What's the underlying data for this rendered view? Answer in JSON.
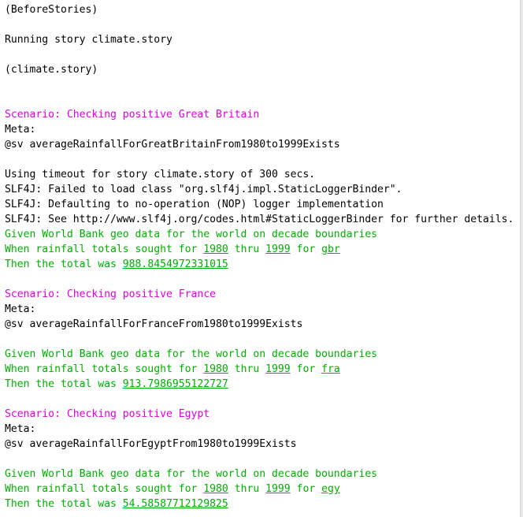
{
  "colors": {
    "scenario": "#e000e0",
    "step": "#00b000",
    "default": "#000000",
    "background": "#ffffff"
  },
  "console": {
    "before_stories": "(BeforeStories)",
    "running_story": "Running story climate.story",
    "story_name": "(climate.story)",
    "scenarios": [
      {
        "title": "Scenario: Checking positive Great Britain",
        "meta_label": "Meta:",
        "meta_value": "@sv averageRainfallForGreatBritainFrom1980to1999Exists",
        "given": "Given World Bank geo data for the world on decade boundaries",
        "when_prefix": "When rainfall totals sought for ",
        "when_from": "1980",
        "when_mid": " thru ",
        "when_to": "1999",
        "when_for": " for ",
        "when_country": "gbr",
        "then_prefix": "Then the total was ",
        "then_value": "988.8454972331015"
      },
      {
        "title": "Scenario: Checking positive France",
        "meta_label": "Meta:",
        "meta_value": "@sv averageRainfallForFranceFrom1980to1999Exists",
        "given": "Given World Bank geo data for the world on decade boundaries",
        "when_prefix": "When rainfall totals sought for ",
        "when_from": "1980",
        "when_mid": " thru ",
        "when_to": "1999",
        "when_for": " for ",
        "when_country": "fra",
        "then_prefix": "Then the total was ",
        "then_value": "913.7986955122727"
      },
      {
        "title": "Scenario: Checking positive Egypt",
        "meta_label": "Meta:",
        "meta_value": "@sv averageRainfallForEgyptFrom1980to1999Exists",
        "given": "Given World Bank geo data for the world on decade boundaries",
        "when_prefix": "When rainfall totals sought for ",
        "when_from": "1980",
        "when_mid": " thru ",
        "when_to": "1999",
        "when_for": " for ",
        "when_country": "egy",
        "then_prefix": "Then the total was ",
        "then_value": "54.58587712129825"
      }
    ],
    "log_lines": [
      "Using timeout for story climate.story of 300 secs.",
      "SLF4J: Failed to load class \"org.slf4j.impl.StaticLoggerBinder\".",
      "SLF4J: Defaulting to no-operation (NOP) logger implementation",
      "SLF4J: See http://www.slf4j.org/codes.html#StaticLoggerBinder for further details."
    ]
  }
}
